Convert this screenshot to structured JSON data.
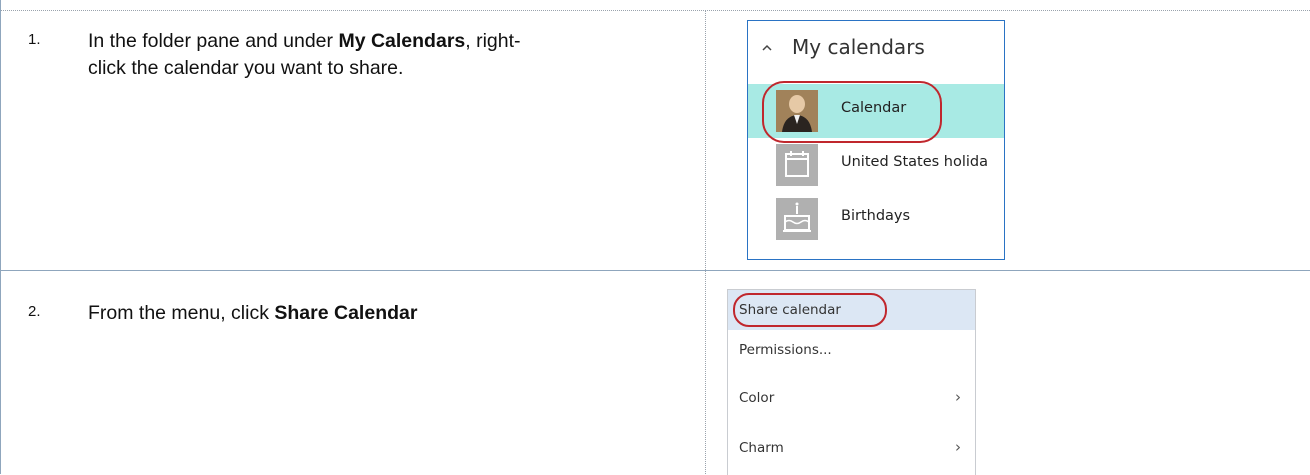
{
  "steps": [
    {
      "number": "1.",
      "text_parts": [
        "In the folder pane and under ",
        "My Calendars",
        ", right-",
        "click the calendar you want to share."
      ]
    },
    {
      "number": "2.",
      "text_parts": [
        "From the menu, click ",
        "Share Calendar"
      ]
    }
  ],
  "folder_pane": {
    "header": "My calendars",
    "header_icon": "chevron-up-icon",
    "items": [
      {
        "label": "Calendar",
        "icon": "profile-photo",
        "selected": true
      },
      {
        "label": "United States holida",
        "icon": "calendar-icon",
        "selected": false
      },
      {
        "label": "Birthdays",
        "icon": "birthday-cake-icon",
        "selected": false
      }
    ]
  },
  "context_menu": {
    "items": [
      {
        "label": "Share calendar",
        "submenu": false,
        "highlighted": true
      },
      {
        "label": "Permissions...",
        "submenu": false,
        "highlighted": false
      },
      {
        "label": "Color",
        "submenu": true,
        "arrow": "›"
      },
      {
        "label": "Charm",
        "submenu": true,
        "arrow": "›"
      }
    ]
  },
  "colors": {
    "selected_row": "#a8eae4",
    "menu_hover": "#dce7f4",
    "callout_oval": "#c0272d",
    "pane_border": "#2a73c4"
  }
}
